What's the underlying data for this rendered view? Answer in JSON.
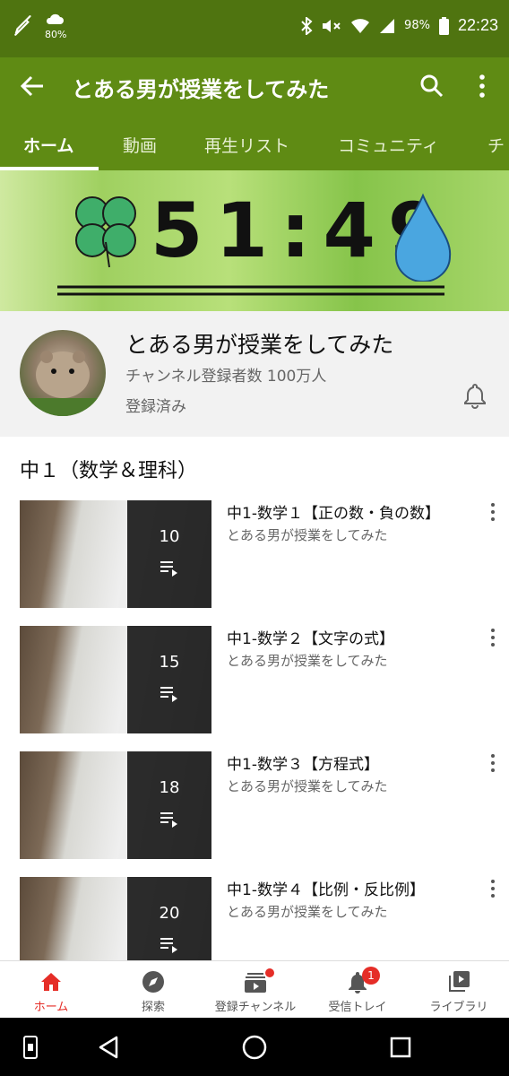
{
  "status_bar": {
    "battery_small": "80%",
    "battery_pct": "98%",
    "time": "22:23"
  },
  "app_bar": {
    "title": "とある男が授業をしてみた"
  },
  "tabs": [
    {
      "label": "ホーム",
      "active": true
    },
    {
      "label": "動画",
      "active": false
    },
    {
      "label": "再生リスト",
      "active": false
    },
    {
      "label": "コミュニティ",
      "active": false
    },
    {
      "label": "チ",
      "active": false
    }
  ],
  "banner": {
    "text": "51:49"
  },
  "channel": {
    "name": "とある男が授業をしてみた",
    "subscribers": "チャンネル登録者数 100万人",
    "status": "登録済み"
  },
  "section": {
    "title": "中１（数学＆理科）"
  },
  "playlists": [
    {
      "title": "中1-数学１【正の数・負の数】",
      "channel": "とある男が授業をしてみた",
      "count": "10"
    },
    {
      "title": "中1-数学２【文字の式】",
      "channel": "とある男が授業をしてみた",
      "count": "15"
    },
    {
      "title": "中1-数学３【方程式】",
      "channel": "とある男が授業をしてみた",
      "count": "18"
    },
    {
      "title": "中1-数学４【比例・反比例】",
      "channel": "とある男が授業をしてみた",
      "count": "20"
    }
  ],
  "bottom_nav": [
    {
      "label": "ホーム",
      "icon": "home-icon",
      "active": true
    },
    {
      "label": "探索",
      "icon": "explore-icon",
      "active": false
    },
    {
      "label": "登録チャンネル",
      "icon": "subscriptions-icon",
      "active": false
    },
    {
      "label": "受信トレイ",
      "icon": "inbox-bell-icon",
      "active": false,
      "badge": "1"
    },
    {
      "label": "ライブラリ",
      "icon": "library-icon",
      "active": false
    }
  ],
  "colors": {
    "app_bar": "#5f8b14",
    "status_bar": "#4f7410",
    "accent_red": "#e52d27"
  }
}
